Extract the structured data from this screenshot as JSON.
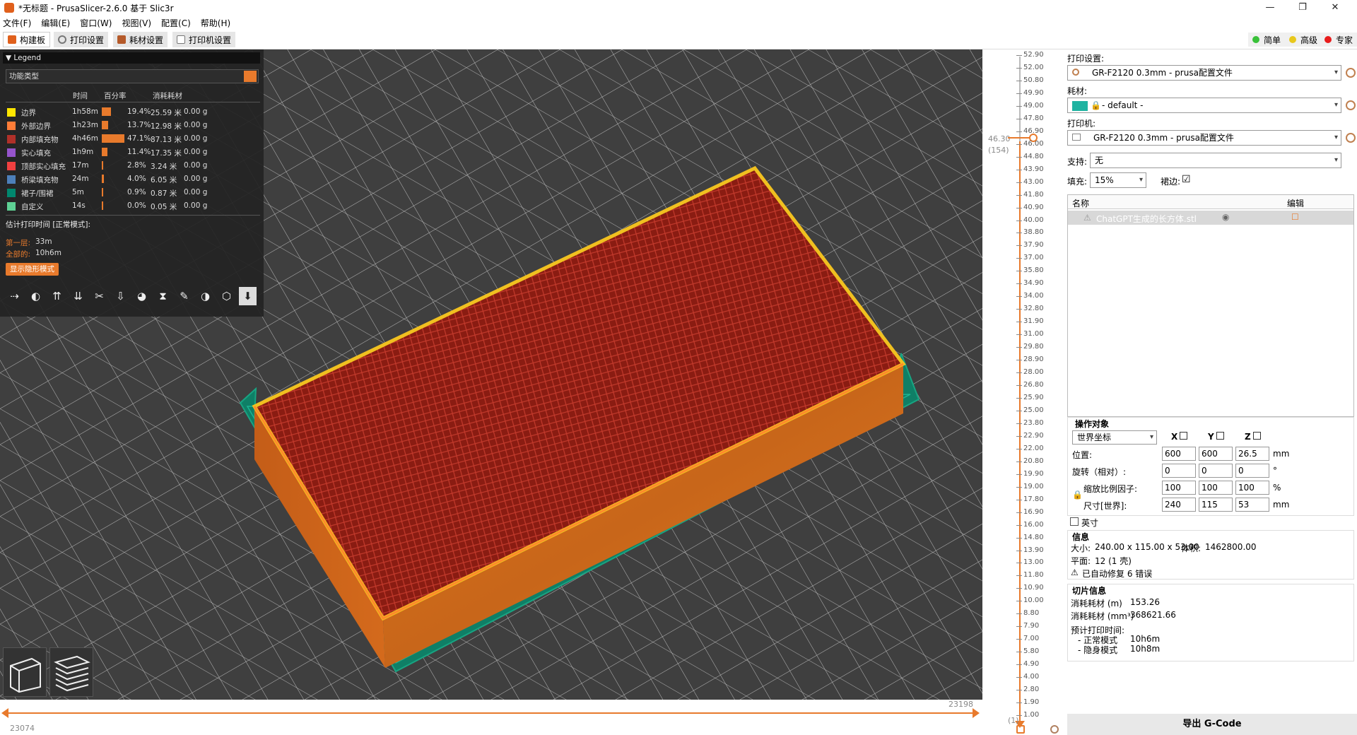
{
  "window": {
    "title": "*无标题 - PrusaSlicer-2.6.0 基于 Slic3r",
    "min": "—",
    "max": "❐",
    "close": "✕"
  },
  "menu": [
    "文件(F)",
    "编辑(E)",
    "窗口(W)",
    "视图(V)",
    "配置(C)",
    "帮助(H)"
  ],
  "tabs": [
    {
      "label": "构建板",
      "active": true
    },
    {
      "label": "打印设置",
      "active": false
    },
    {
      "label": "耗材设置",
      "active": false
    },
    {
      "label": "打印机设置",
      "active": false
    }
  ],
  "modes": [
    {
      "label": "简单",
      "color": "#39c139"
    },
    {
      "label": "高级",
      "color": "#e8c81c"
    },
    {
      "label": "专家",
      "color": "#e81c1c"
    }
  ],
  "legend": {
    "title": "Legend",
    "view_type": "功能类型",
    "col_time": "时间",
    "col_percent": "百分率",
    "col_used": "消耗耗材",
    "rows": [
      {
        "name": "边界",
        "color": "#ffe600",
        "time": "1h58m",
        "pct": "19.4%",
        "pct_value": 19.4,
        "len": "25.59 米",
        "g": "0.00 g"
      },
      {
        "name": "外部边界",
        "color": "#ff7d38",
        "time": "1h23m",
        "pct": "13.7%",
        "pct_value": 13.7,
        "len": "12.98 米",
        "g": "0.00 g"
      },
      {
        "name": "内部填充物",
        "color": "#b03029",
        "time": "4h46m",
        "pct": "47.1%",
        "pct_value": 47.1,
        "len": "87.13 米",
        "g": "0.00 g"
      },
      {
        "name": "实心填充",
        "color": "#9654cc",
        "time": "1h9m",
        "pct": "11.4%",
        "pct_value": 11.4,
        "len": "17.35 米",
        "g": "0.00 g"
      },
      {
        "name": "顶部实心填充",
        "color": "#f04040",
        "time": "17m",
        "pct": "2.8%",
        "pct_value": 2.8,
        "len": "3.24 米",
        "g": "0.00 g"
      },
      {
        "name": "桥梁填充物",
        "color": "#4d80ba",
        "time": "24m",
        "pct": "4.0%",
        "pct_value": 4.0,
        "len": "6.05 米",
        "g": "0.00 g"
      },
      {
        "name": "裙子/围裙",
        "color": "#00876e",
        "time": "5m",
        "pct": "0.9%",
        "pct_value": 0.9,
        "len": "0.87 米",
        "g": "0.00 g"
      },
      {
        "name": "自定义",
        "color": "#5ed194",
        "time": "14s",
        "pct": "0.0%",
        "pct_value": 0.0,
        "len": "0.05 米",
        "g": "0.00 g"
      }
    ],
    "est_title": "估计打印时间 [正常模式]:",
    "first_layer_label": "第一层:",
    "first_layer": "33m",
    "total_label": "全部的:",
    "total": "10h6m",
    "stealth_button": "显示隐形模式",
    "tool_icons": [
      "travel-icon",
      "wipe-icon",
      "retractions-icon",
      "deretractions-icon",
      "seams-icon",
      "tool-changes-icon",
      "color-changes-icon",
      "pause-icon",
      "custom-gcode-icon",
      "center-of-gravity-icon",
      "shells-icon",
      "tool-marker-icon"
    ]
  },
  "hslider": {
    "left": "23074",
    "right": "23198"
  },
  "vslider": {
    "ticks": [
      "52.90",
      "52.00",
      "50.80",
      "49.90",
      "49.00",
      "47.80",
      "46.90",
      "46.00",
      "44.80",
      "43.90",
      "43.00",
      "41.80",
      "40.90",
      "40.00",
      "38.80",
      "37.90",
      "37.00",
      "35.80",
      "34.90",
      "34.00",
      "32.80",
      "31.90",
      "31.00",
      "29.80",
      "28.90",
      "28.00",
      "26.80",
      "25.90",
      "25.00",
      "23.80",
      "22.90",
      "22.00",
      "20.80",
      "19.90",
      "19.00",
      "17.80",
      "16.90",
      "16.00",
      "14.80",
      "13.90",
      "13.00",
      "11.80",
      "10.90",
      "10.00",
      "8.80",
      "7.90",
      "7.00",
      "5.80",
      "4.90",
      "4.00",
      "2.80",
      "1.90",
      "1.00"
    ],
    "current_value": "46.30",
    "current_layer": "(154)",
    "bottom_layer": "(1)"
  },
  "panel": {
    "print_label": "打印设置:",
    "print_value": "GR-F2120 0.3mm - prusa配置文件",
    "filament_label": "耗材:",
    "filament_value": "- default -",
    "filament_color": "#1fb3a1",
    "printer_label": "打印机:",
    "printer_value": "GR-F2120 0.3mm - prusa配置文件",
    "support_label": "支持:",
    "support_value": "无",
    "infill_label": "填充:",
    "infill_value": "15%",
    "brim_label": "裙边:",
    "brim_checked": "☑",
    "list_col_name": "名称",
    "list_col_edit": "编辑",
    "object_name": "ChatGPT生成的长方体.stl",
    "manip_title": "操作对象",
    "coord_system": "世界坐标",
    "axis_x": "X",
    "axis_y": "Y",
    "axis_z": "Z",
    "position_label": "位置:",
    "position": [
      "600",
      "600",
      "26.5"
    ],
    "position_unit": "mm",
    "rotation_label": "旋转（相对）:",
    "rotation": [
      "0",
      "0",
      "0"
    ],
    "rotation_unit": "°",
    "scale_label": "缩放比例因子:",
    "scale": [
      "100",
      "100",
      "100"
    ],
    "scale_unit": "%",
    "size_label": "尺寸[世界]:",
    "size": [
      "240",
      "115",
      "53"
    ],
    "size_unit": "mm",
    "inch_label": "英寸",
    "info_title": "信息",
    "size_info_label": "大小:",
    "size_info": "240.00 x 115.00 x 53.00",
    "volume_label": "体积:",
    "volume": "1462800.00",
    "facets_label": "平面:",
    "facets": "12 (1 壳)",
    "repair_text": "已自动修复 6 错误",
    "slice_title": "切片信息",
    "used_m_label": "消耗耗材 (m)",
    "used_m": "153.26",
    "used_mm3_label": "消耗耗材 (mm³)",
    "used_mm3": "368621.66",
    "est_time_label": "预计打印时间:",
    "normal_label": "- 正常模式",
    "normal_time": "10h6m",
    "stealth_label": "- 隐身模式",
    "stealth_time": "10h8m",
    "export_button": "导出 G-Code"
  }
}
